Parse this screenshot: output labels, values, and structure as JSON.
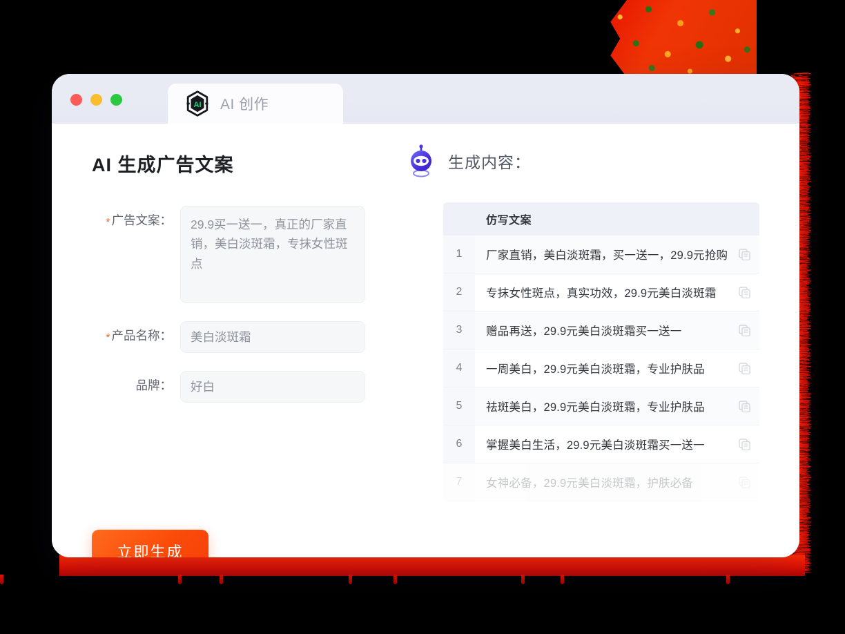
{
  "window": {
    "traffic_lights": [
      {
        "name": "close",
        "color": "#fc5b57"
      },
      {
        "name": "minimize",
        "color": "#f9bd2e"
      },
      {
        "name": "maximize",
        "color": "#2bc940"
      }
    ],
    "tab": {
      "label": "AI 创作",
      "logo_text": "AI",
      "logo_icon": "ai-hexagon-logo-icon"
    }
  },
  "left": {
    "page_title": "AI 生成广告文案",
    "fields": [
      {
        "label": "广告文案：",
        "required": true,
        "value": "29.9买一送一，真正的厂家直销，美白淡斑霜，专抹女性斑点",
        "type": "textarea"
      },
      {
        "label": "产品名称：",
        "required": true,
        "value": "美白淡斑霜",
        "type": "text"
      },
      {
        "label": "品牌：",
        "required": false,
        "value": "好白",
        "type": "text"
      }
    ],
    "submit_button": "立即生成"
  },
  "right": {
    "robot_icon": "robot-head-icon",
    "section_title": "生成内容：",
    "table": {
      "columns": [
        "仿写文案"
      ],
      "rows": [
        {
          "index": "1",
          "text": "厂家直销，美白淡斑霜，买一送一，29.9元抢购",
          "faded": false
        },
        {
          "index": "2",
          "text": "专抹女性斑点，真实功效，29.9元美白淡斑霜",
          "faded": false
        },
        {
          "index": "3",
          "text": "赠品再送，29.9元美白淡斑霜买一送一",
          "faded": false
        },
        {
          "index": "4",
          "text": "一周美白，29.9元美白淡斑霜，专业护肤品",
          "faded": false
        },
        {
          "index": "5",
          "text": "祛斑美白，29.9元美白淡斑霜，专业护肤品",
          "faded": false
        },
        {
          "index": "6",
          "text": "掌握美白生活，29.9元美白淡斑霜买一送一",
          "faded": false
        },
        {
          "index": "7",
          "text": "女神必备，29.9元美白淡斑霜，护肤必备",
          "faded": true
        }
      ],
      "copy_icon": "copy-icon"
    }
  },
  "colors": {
    "accent_orange": "#fb4c0a",
    "required_star": "#fa6a35",
    "logo_green": "#12d97a",
    "robot_purple": "#4a32d8",
    "titlebar_bg": "#e7eaf3",
    "table_head_bg": "#eef1f7",
    "decoration_red": "#e51000"
  },
  "decorations": {
    "top_right_shape": "textured-red-ribbon",
    "edge": "torn-red-edge"
  }
}
